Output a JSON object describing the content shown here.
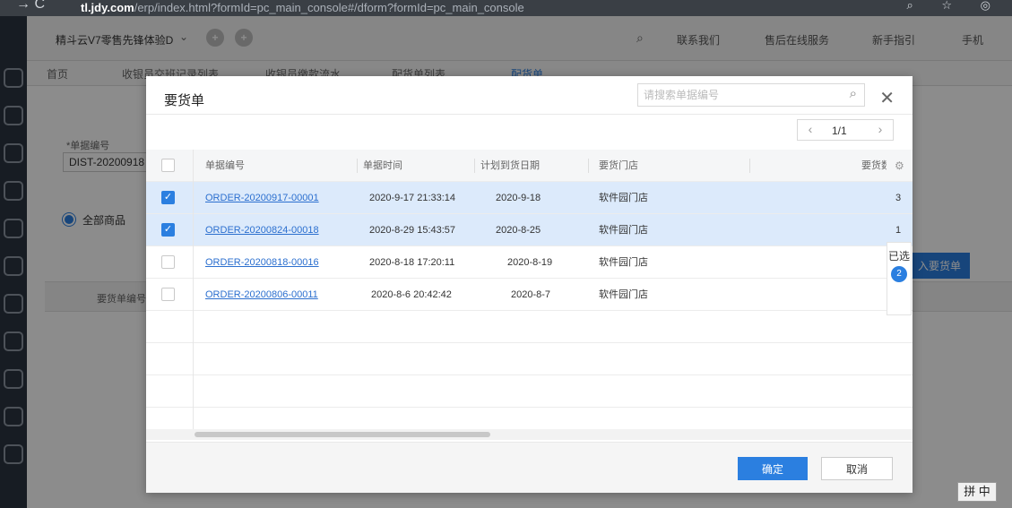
{
  "browser": {
    "nav_glyphs": "→ C",
    "url_host": "tl.jdy.com",
    "url_path": "/erp/index.html?formId=pc_main_console#/dform?formId=pc_main_console",
    "right_glyphs": "⌕ ☆ ◎"
  },
  "topbar": {
    "tenant": "精斗云V7零售先锋体验D",
    "links": [
      "联系我们",
      "售后在线服务",
      "新手指引",
      "手机"
    ]
  },
  "tabs": {
    "home": "首页",
    "items": [
      "收银员交班记录列表",
      "收银员缴款流水",
      "配货单列表",
      "配货单"
    ]
  },
  "page": {
    "doc_no_label": "*单据编号",
    "doc_no_value": "DIST-20200918",
    "all_goods_label": "全部商品",
    "table_col": "要货单编号",
    "import_button": "入要货单"
  },
  "modal": {
    "title": "要货单",
    "search_placeholder": "请搜索单据编号",
    "pager_text": "1/1",
    "columns": [
      "单据编号",
      "单据时间",
      "计划到货日期",
      "要货门店",
      "要货数"
    ],
    "rows": [
      {
        "no": "ORDER-20200917-00001",
        "time": "2020-9-17 21:33:14",
        "plan": "2020-9-18",
        "store": "软件园门店",
        "qty": "3",
        "checked": true
      },
      {
        "no": "ORDER-20200824-00018",
        "time": "2020-8-29 15:43:57",
        "plan": "2020-8-25",
        "store": "软件园门店",
        "qty": "1",
        "checked": true
      },
      {
        "no": "ORDER-20200818-00016",
        "time": "2020-8-18 17:20:11",
        "plan": "2020-8-19",
        "store": "软件园门店",
        "qty": "",
        "checked": false
      },
      {
        "no": "ORDER-20200806-00011",
        "time": "2020-8-6 20:42:42",
        "plan": "2020-8-7",
        "store": "软件园门店",
        "qty": "",
        "checked": false
      }
    ],
    "selected_label": "已选",
    "selected_count": "2",
    "ok_label": "确定",
    "cancel_label": "取消"
  },
  "ime": "拼 中"
}
